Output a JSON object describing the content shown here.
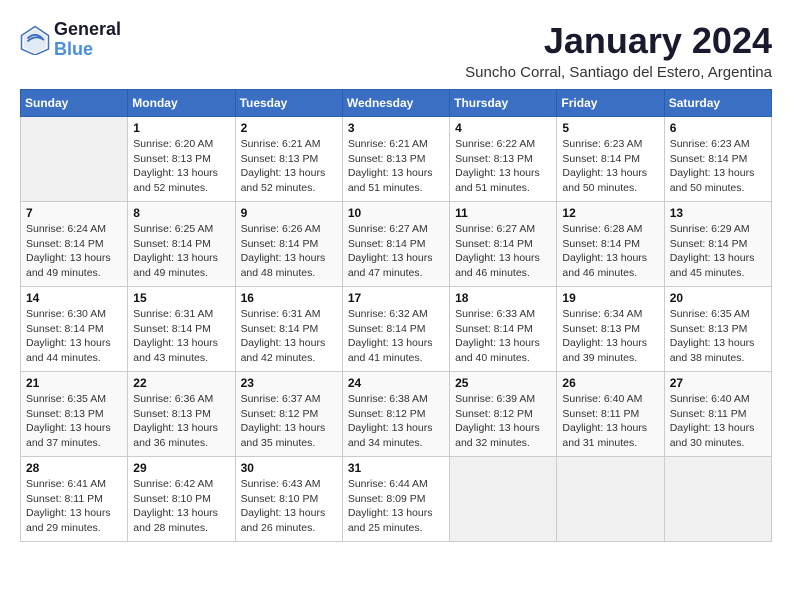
{
  "logo": {
    "line1": "General",
    "line2": "Blue"
  },
  "title": "January 2024",
  "subtitle": "Suncho Corral, Santiago del Estero, Argentina",
  "days_of_week": [
    "Sunday",
    "Monday",
    "Tuesday",
    "Wednesday",
    "Thursday",
    "Friday",
    "Saturday"
  ],
  "weeks": [
    [
      {
        "day": "",
        "info": ""
      },
      {
        "day": "1",
        "info": "Sunrise: 6:20 AM\nSunset: 8:13 PM\nDaylight: 13 hours\nand 52 minutes."
      },
      {
        "day": "2",
        "info": "Sunrise: 6:21 AM\nSunset: 8:13 PM\nDaylight: 13 hours\nand 52 minutes."
      },
      {
        "day": "3",
        "info": "Sunrise: 6:21 AM\nSunset: 8:13 PM\nDaylight: 13 hours\nand 51 minutes."
      },
      {
        "day": "4",
        "info": "Sunrise: 6:22 AM\nSunset: 8:13 PM\nDaylight: 13 hours\nand 51 minutes."
      },
      {
        "day": "5",
        "info": "Sunrise: 6:23 AM\nSunset: 8:14 PM\nDaylight: 13 hours\nand 50 minutes."
      },
      {
        "day": "6",
        "info": "Sunrise: 6:23 AM\nSunset: 8:14 PM\nDaylight: 13 hours\nand 50 minutes."
      }
    ],
    [
      {
        "day": "7",
        "info": "Sunrise: 6:24 AM\nSunset: 8:14 PM\nDaylight: 13 hours\nand 49 minutes."
      },
      {
        "day": "8",
        "info": "Sunrise: 6:25 AM\nSunset: 8:14 PM\nDaylight: 13 hours\nand 49 minutes."
      },
      {
        "day": "9",
        "info": "Sunrise: 6:26 AM\nSunset: 8:14 PM\nDaylight: 13 hours\nand 48 minutes."
      },
      {
        "day": "10",
        "info": "Sunrise: 6:27 AM\nSunset: 8:14 PM\nDaylight: 13 hours\nand 47 minutes."
      },
      {
        "day": "11",
        "info": "Sunrise: 6:27 AM\nSunset: 8:14 PM\nDaylight: 13 hours\nand 46 minutes."
      },
      {
        "day": "12",
        "info": "Sunrise: 6:28 AM\nSunset: 8:14 PM\nDaylight: 13 hours\nand 46 minutes."
      },
      {
        "day": "13",
        "info": "Sunrise: 6:29 AM\nSunset: 8:14 PM\nDaylight: 13 hours\nand 45 minutes."
      }
    ],
    [
      {
        "day": "14",
        "info": "Sunrise: 6:30 AM\nSunset: 8:14 PM\nDaylight: 13 hours\nand 44 minutes."
      },
      {
        "day": "15",
        "info": "Sunrise: 6:31 AM\nSunset: 8:14 PM\nDaylight: 13 hours\nand 43 minutes."
      },
      {
        "day": "16",
        "info": "Sunrise: 6:31 AM\nSunset: 8:14 PM\nDaylight: 13 hours\nand 42 minutes."
      },
      {
        "day": "17",
        "info": "Sunrise: 6:32 AM\nSunset: 8:14 PM\nDaylight: 13 hours\nand 41 minutes."
      },
      {
        "day": "18",
        "info": "Sunrise: 6:33 AM\nSunset: 8:14 PM\nDaylight: 13 hours\nand 40 minutes."
      },
      {
        "day": "19",
        "info": "Sunrise: 6:34 AM\nSunset: 8:13 PM\nDaylight: 13 hours\nand 39 minutes."
      },
      {
        "day": "20",
        "info": "Sunrise: 6:35 AM\nSunset: 8:13 PM\nDaylight: 13 hours\nand 38 minutes."
      }
    ],
    [
      {
        "day": "21",
        "info": "Sunrise: 6:35 AM\nSunset: 8:13 PM\nDaylight: 13 hours\nand 37 minutes."
      },
      {
        "day": "22",
        "info": "Sunrise: 6:36 AM\nSunset: 8:13 PM\nDaylight: 13 hours\nand 36 minutes."
      },
      {
        "day": "23",
        "info": "Sunrise: 6:37 AM\nSunset: 8:12 PM\nDaylight: 13 hours\nand 35 minutes."
      },
      {
        "day": "24",
        "info": "Sunrise: 6:38 AM\nSunset: 8:12 PM\nDaylight: 13 hours\nand 34 minutes."
      },
      {
        "day": "25",
        "info": "Sunrise: 6:39 AM\nSunset: 8:12 PM\nDaylight: 13 hours\nand 32 minutes."
      },
      {
        "day": "26",
        "info": "Sunrise: 6:40 AM\nSunset: 8:11 PM\nDaylight: 13 hours\nand 31 minutes."
      },
      {
        "day": "27",
        "info": "Sunrise: 6:40 AM\nSunset: 8:11 PM\nDaylight: 13 hours\nand 30 minutes."
      }
    ],
    [
      {
        "day": "28",
        "info": "Sunrise: 6:41 AM\nSunset: 8:11 PM\nDaylight: 13 hours\nand 29 minutes."
      },
      {
        "day": "29",
        "info": "Sunrise: 6:42 AM\nSunset: 8:10 PM\nDaylight: 13 hours\nand 28 minutes."
      },
      {
        "day": "30",
        "info": "Sunrise: 6:43 AM\nSunset: 8:10 PM\nDaylight: 13 hours\nand 26 minutes."
      },
      {
        "day": "31",
        "info": "Sunrise: 6:44 AM\nSunset: 8:09 PM\nDaylight: 13 hours\nand 25 minutes."
      },
      {
        "day": "",
        "info": ""
      },
      {
        "day": "",
        "info": ""
      },
      {
        "day": "",
        "info": ""
      }
    ]
  ]
}
